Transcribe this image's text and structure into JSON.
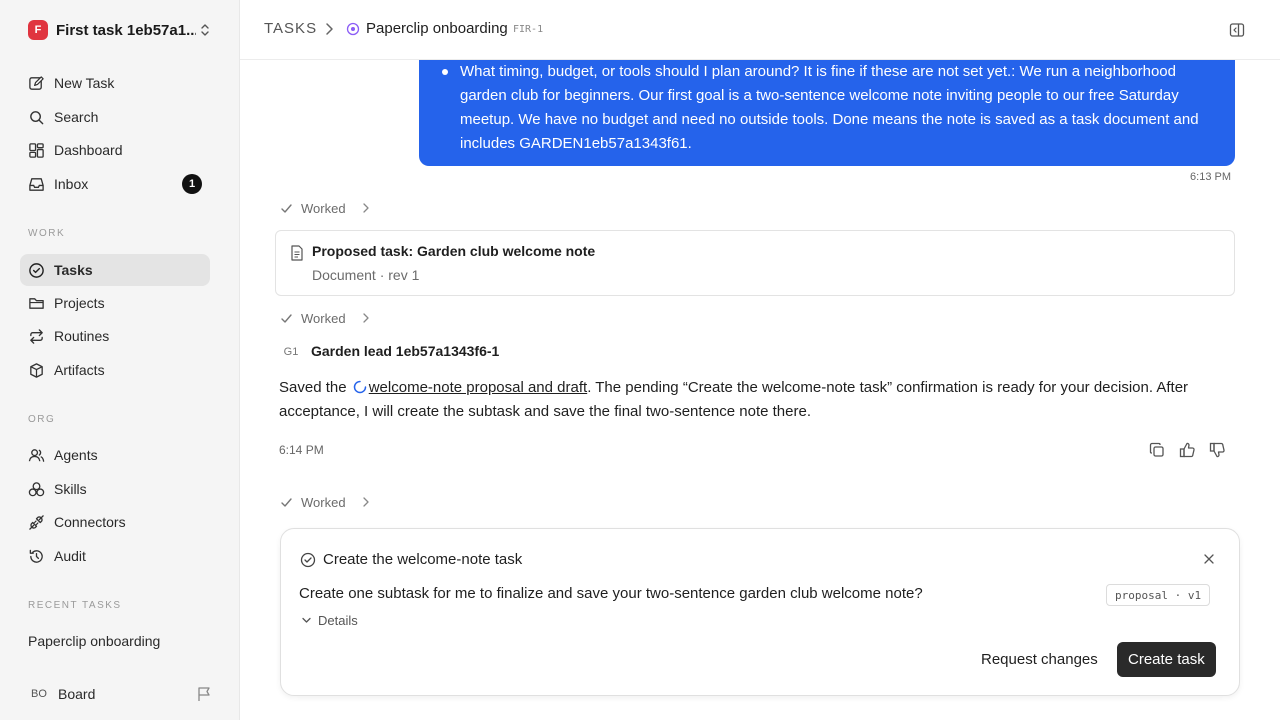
{
  "workspace": {
    "name": "First task 1eb57a1...",
    "logo_letter": "F",
    "logo_color": "#e0343f"
  },
  "sidebar": {
    "top_items": [
      {
        "label": "New Task",
        "icon": "new-task-icon"
      },
      {
        "label": "Search",
        "icon": "search-icon"
      },
      {
        "label": "Dashboard",
        "icon": "dashboard-icon"
      },
      {
        "label": "Inbox",
        "icon": "inbox-icon",
        "badge": "1"
      }
    ],
    "work_label": "WORK",
    "work_items": [
      {
        "label": "Tasks",
        "icon": "tasks-icon",
        "active": true
      },
      {
        "label": "Projects",
        "icon": "folder-icon"
      },
      {
        "label": "Routines",
        "icon": "repeat-icon"
      },
      {
        "label": "Artifacts",
        "icon": "box-icon"
      }
    ],
    "org_label": "ORG",
    "org_items": [
      {
        "label": "Agents",
        "icon": "users-icon"
      },
      {
        "label": "Skills",
        "icon": "skills-icon"
      },
      {
        "label": "Connectors",
        "icon": "plug-icon"
      },
      {
        "label": "Audit",
        "icon": "history-icon"
      }
    ],
    "recent_label": "RECENT TASKS",
    "recent_item": "Paperclip onboarding",
    "board": {
      "initials": "BO",
      "name": "Board"
    }
  },
  "header": {
    "root": "TASKS",
    "title": "Paperclip onboarding",
    "key": "FIR-1"
  },
  "user_message": {
    "text": "What timing, budget, or tools should I plan around? It is fine if these are not set yet.: We run a neighborhood garden club for beginners. Our first goal is a two-sentence welcome note inviting people to our free Saturday meetup. We have no budget and need no outside tools. Done means the note is saved as a task document and includes GARDEN1eb57a1343f61.",
    "time": "6:13 PM"
  },
  "worked_label": "Worked",
  "document_card": {
    "title": "Proposed task: Garden club welcome note",
    "subtitle": "Document · rev 1"
  },
  "agent": {
    "initials": "G1",
    "name": "Garden lead 1eb57a1343f6-1"
  },
  "agent_message": {
    "before": "Saved the ",
    "link": "welcome-note proposal and draft",
    "after": ". The pending “Create the welcome-note task” confirmation is ready for your decision. After acceptance, I will create the subtask and save the final two-sentence note there.",
    "time": "6:14 PM"
  },
  "confirm": {
    "title": "Create the welcome-note task",
    "question": "Create one subtask for me to finalize and save your two-sentence garden club welcome note?",
    "tag": "proposal · v1",
    "details_label": "Details",
    "reject_label": "Request changes",
    "accept_label": "Create task"
  },
  "colors": {
    "accent_blue": "#2563eb",
    "primary_button": "#2a2a2a",
    "status_purple": "#8b5cf6"
  }
}
